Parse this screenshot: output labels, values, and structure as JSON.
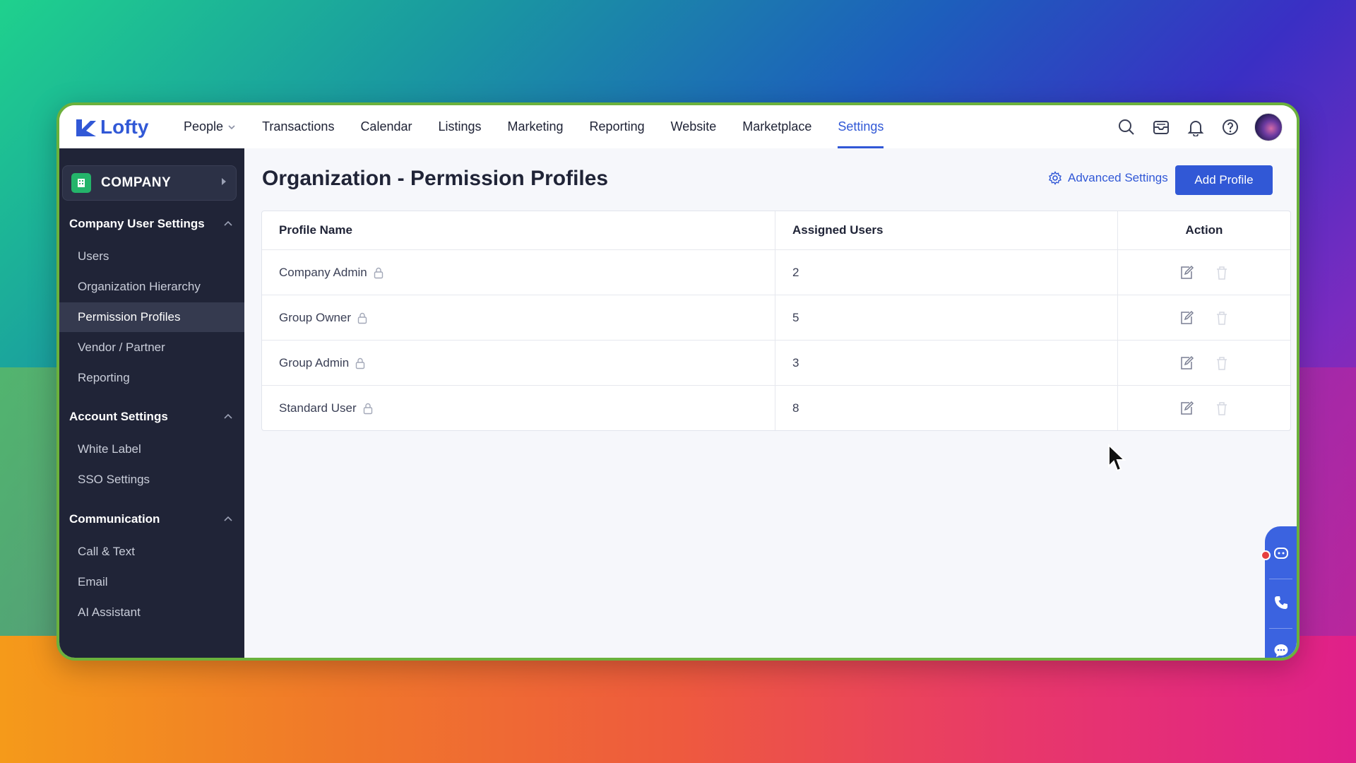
{
  "app": {
    "brand": "Lofty"
  },
  "nav": {
    "items": [
      "People",
      "Transactions",
      "Calendar",
      "Listings",
      "Marketing",
      "Reporting",
      "Website",
      "Marketplace",
      "Settings"
    ],
    "active": "Settings"
  },
  "sidebar": {
    "company_label": "COMPANY",
    "sections": [
      {
        "title": "Company User Settings",
        "items": [
          "Users",
          "Organization Hierarchy",
          "Permission Profiles",
          "Vendor / Partner",
          "Reporting"
        ]
      },
      {
        "title": "Account Settings",
        "items": [
          "White Label",
          "SSO Settings"
        ]
      },
      {
        "title": "Communication",
        "items": [
          "Call & Text",
          "Email",
          "AI Assistant"
        ]
      }
    ],
    "active_item": "Permission Profiles"
  },
  "page": {
    "title": "Organization - Permission Profiles",
    "advanced_settings": "Advanced Settings",
    "add_profile": "Add Profile"
  },
  "table": {
    "headers": [
      "Profile Name",
      "Assigned Users",
      "Action"
    ],
    "rows": [
      {
        "name": "Company Admin",
        "users": "2"
      },
      {
        "name": "Group Owner",
        "users": "5"
      },
      {
        "name": "Group Admin",
        "users": "3"
      },
      {
        "name": "Standard User",
        "users": "8"
      }
    ]
  },
  "colors": {
    "accent": "#3158d6",
    "sidebar": "#202437",
    "company_icon": "#24b46a"
  },
  "icons": [
    "search-icon",
    "inbox-icon",
    "bell-icon",
    "help-icon",
    "lock-icon",
    "edit-icon",
    "trash-icon",
    "chatbot-icon",
    "phone-icon",
    "chat-icon"
  ]
}
